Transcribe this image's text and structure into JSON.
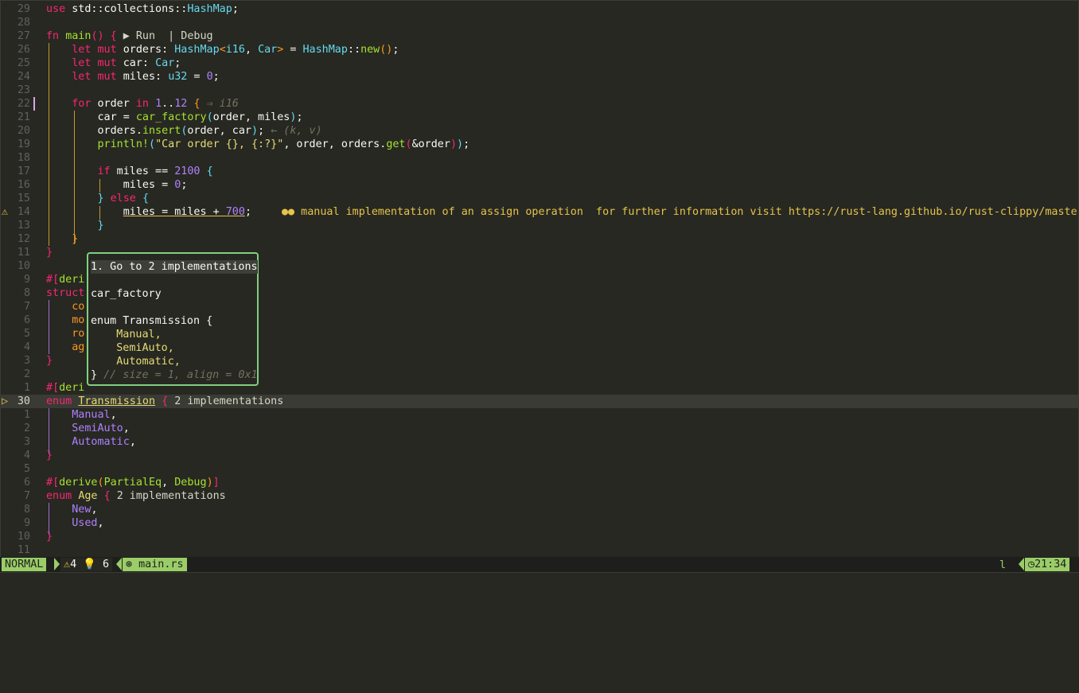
{
  "lines": [
    {
      "n": "29",
      "html": "<span class=\"kw\">use</span> std::collections::<span class=\"ty\">HashMap</span>;"
    },
    {
      "n": "28",
      "html": ""
    },
    {
      "n": "27",
      "html": "<span class=\"kw\">fn</span> <span class=\"fn\">main</span><span class=\"b1\">()</span> <span class=\"b1\">{</span> <span class=\"lens\">▶ Run  | Debug</span>"
    },
    {
      "n": "26",
      "html": "    <span class=\"kw\">let</span> <span class=\"kw\">mut</span> orders: <span class=\"ty\">HashMap</span><span class=\"b2\">&lt;</span><span class=\"ty\">i16</span>, <span class=\"ty\">Car</span><span class=\"b2\">&gt;</span> = <span class=\"ty\">HashMap</span>::<span class=\"fn\">new</span><span class=\"b2\">()</span>;"
    },
    {
      "n": "25",
      "html": "    <span class=\"kw\">let</span> <span class=\"kw\">mut</span> car: <span class=\"ty\">Car</span>;"
    },
    {
      "n": "24",
      "html": "    <span class=\"kw\">let</span> <span class=\"kw\">mut</span> miles: <span class=\"ty\">u32</span> = <span class=\"num-c\">0</span>;"
    },
    {
      "n": "23",
      "html": ""
    },
    {
      "n": "22",
      "html": "    <span class=\"kw\">for</span> order <span class=\"kw\">in</span> <span class=\"num-c\">1</span>..<span class=\"num-c\">12</span> <span class=\"b2\">{</span> <span class=\"hint\">⇒ i16</span>"
    },
    {
      "n": "21",
      "html": "        car = <span class=\"fn\">car_factory</span><span class=\"b3\">(</span>order, miles<span class=\"b3\">)</span>;"
    },
    {
      "n": "20",
      "html": "        orders.<span class=\"fn\">insert</span><span class=\"b3\">(</span>order, car<span class=\"b3\">)</span>; <span class=\"hint\">← (k, v)</span>"
    },
    {
      "n": "19",
      "html": "        <span class=\"mac\">println!</span><span class=\"b3\">(</span><span class=\"str\">\"Car order {}, {:?}\"</span>, order, orders.<span class=\"fn\">get</span><span class=\"b1\">(</span>&amp;order<span class=\"b1\">)</span><span class=\"b3\">)</span>;"
    },
    {
      "n": "18",
      "html": ""
    },
    {
      "n": "17",
      "html": "        <span class=\"kw\">if</span> miles == <span class=\"num-c\">2100</span> <span class=\"b3\">{</span>"
    },
    {
      "n": "16",
      "html": "            miles = <span class=\"num-c\">0</span>;"
    },
    {
      "n": "15",
      "html": "        <span class=\"b3\">}</span> <span class=\"kw\">else</span> <span class=\"b3\">{</span>"
    },
    {
      "n": "14",
      "html": "            <span class=\"underline\">miles = miles + <span class=\"num-c\">700</span></span>;"
    },
    {
      "n": "13",
      "html": "        <span class=\"b3\">}</span>"
    },
    {
      "n": "12",
      "html": "    <span class=\"b2\">}</span>"
    },
    {
      "n": "11",
      "html": "<span class=\"b1\">}</span>"
    },
    {
      "n": "10",
      "html": ""
    },
    {
      "n": "9",
      "html": "<span class=\"kw\">#</span><span class=\"b1\">[</span><span class=\"attr\">deri</span>"
    },
    {
      "n": "8",
      "html": "<span class=\"kw\">struct</span>"
    },
    {
      "n": "7",
      "html": "    <span class=\"field\">co</span>"
    },
    {
      "n": "6",
      "html": "    <span class=\"field\">mo</span>"
    },
    {
      "n": "5",
      "html": "    <span class=\"field\">ro</span>"
    },
    {
      "n": "4",
      "html": "    <span class=\"field\">ag</span>"
    },
    {
      "n": "3",
      "html": "<span class=\"b1\">}</span>"
    },
    {
      "n": "2",
      "html": ""
    },
    {
      "n": "1",
      "html": "<span class=\"kw\">#</span><span class=\"b1\">[</span><span class=\"attr\">deri</span>"
    },
    {
      "n": "30",
      "html": "<span class=\"kw\">enum</span> <span class=\"ty\" style=\"color:#e6db74;text-decoration:underline\">Transmission</span> <span class=\"b1\">{</span> <span class=\"lens\">2 implementations</span>",
      "cur": true
    },
    {
      "n": "1",
      "html": "    <span class=\"variant2\">Manual</span>,"
    },
    {
      "n": "2",
      "html": "    <span class=\"variant2\">SemiAuto</span>,"
    },
    {
      "n": "3",
      "html": "    <span class=\"variant2\">Automatic</span>,"
    },
    {
      "n": "4",
      "html": "<span class=\"b1\">}</span>"
    },
    {
      "n": "5",
      "html": ""
    },
    {
      "n": "6",
      "html": "<span class=\"kw\">#</span><span class=\"b1\">[</span><span class=\"attr\">derive</span><span class=\"b2\">(</span><span class=\"attr\">PartialEq</span>, <span class=\"attr\">Debug</span><span class=\"b2\">)</span><span class=\"b1\">]</span>"
    },
    {
      "n": "7",
      "html": "<span class=\"kw\">enum</span> <span class=\"ty\" style=\"color:#e6db74\">Age</span> <span class=\"b1\">{</span> <span class=\"lens\">2 implementations</span>"
    },
    {
      "n": "8",
      "html": "    <span class=\"variant2\">New</span>,"
    },
    {
      "n": "9",
      "html": "    <span class=\"variant2\">Used</span>,"
    },
    {
      "n": "10",
      "html": "<span class=\"b1\">}</span>"
    },
    {
      "n": "11",
      "html": ""
    }
  ],
  "diagnostic_text": "●● manual implementation of an assign operation  for further information visit https://rust-lang.github.io/rust-clippy/master",
  "popup": {
    "header": "1. Go to 2 implementations",
    "name": "car_factory",
    "code1": "enum Transmission {",
    "code2": "    Manual,",
    "code3": "    SemiAuto,",
    "code4": "    Automatic,",
    "code5_brace": "}",
    "code5_comment": " // size = 1, align = 0x1"
  },
  "status": {
    "mode": "NORMAL",
    "warnings": "4",
    "hints": "6",
    "file": "main.rs",
    "right_char": "l",
    "time": "21:34"
  },
  "colors": {
    "accent": "#9acd68",
    "background": "#272822",
    "keyword": "#f92672",
    "type": "#66d9ef",
    "function": "#a6e22e"
  }
}
